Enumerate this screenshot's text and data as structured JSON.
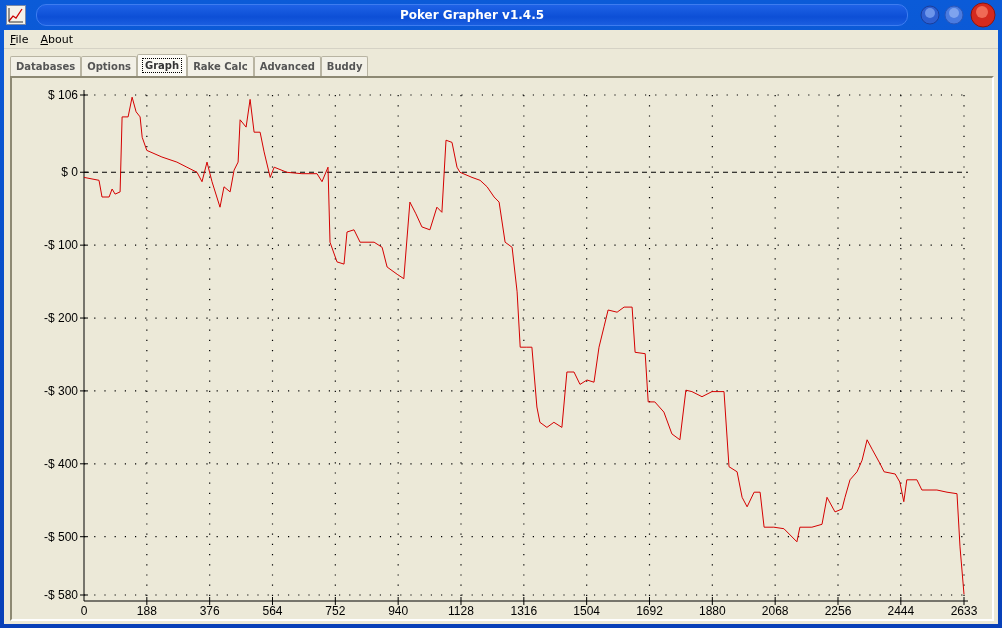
{
  "window": {
    "title": "Poker Grapher v1.4.5"
  },
  "menu": [
    "File",
    "About"
  ],
  "tabs": [
    {
      "label": "Databases",
      "selected": false
    },
    {
      "label": "Options",
      "selected": false
    },
    {
      "label": "Graph",
      "selected": true
    },
    {
      "label": "Rake Calc",
      "selected": false
    },
    {
      "label": "Advanced",
      "selected": false
    },
    {
      "label": "Buddy",
      "selected": false
    }
  ],
  "graph": {
    "chart_data": {
      "type": "line",
      "xlim": [
        0,
        2633
      ],
      "ylim": [
        -580,
        106
      ],
      "xticks": [
        0,
        188,
        376,
        564,
        752,
        940,
        1128,
        1316,
        1504,
        1692,
        1880,
        2068,
        2256,
        2444,
        2633
      ],
      "yticks": [
        {
          "value": 106,
          "label": "$ 106"
        },
        {
          "value": 0,
          "label": "$ 0"
        },
        {
          "value": -100,
          "label": "-$ 100"
        },
        {
          "value": -200,
          "label": "-$ 200"
        },
        {
          "value": -300,
          "label": "-$ 300"
        },
        {
          "value": -400,
          "label": "-$ 400"
        },
        {
          "value": -500,
          "label": "-$ 500"
        },
        {
          "value": -580,
          "label": "-$ 580"
        }
      ],
      "x": [
        0,
        45,
        54,
        75,
        84,
        93,
        108,
        114,
        132,
        144,
        156,
        168,
        174,
        188,
        233,
        278,
        308,
        338,
        353,
        368,
        383,
        407,
        419,
        437,
        449,
        461,
        467,
        485,
        497,
        509,
        527,
        539,
        557,
        569,
        607,
        652,
        697,
        712,
        730,
        736,
        757,
        778,
        787,
        808,
        826,
        868,
        892,
        907,
        937,
        957,
        975,
        993,
        1011,
        1035,
        1056,
        1071,
        1083,
        1101,
        1116,
        1125,
        1161,
        1185,
        1206,
        1227,
        1242,
        1260,
        1281,
        1296,
        1305,
        1325,
        1340,
        1355,
        1364,
        1385,
        1406,
        1430,
        1445,
        1466,
        1484,
        1505,
        1526,
        1541,
        1556,
        1568,
        1595,
        1616,
        1640,
        1649,
        1679,
        1688,
        1708,
        1735,
        1759,
        1783,
        1801,
        1819,
        1849,
        1879,
        1915,
        1930,
        1954,
        1969,
        1984,
        2005,
        2023,
        2035,
        2064,
        2094,
        2133,
        2142,
        2178,
        2208,
        2223,
        2247,
        2268,
        2277,
        2292,
        2313,
        2328,
        2343,
        2358,
        2382,
        2394,
        2427,
        2441,
        2453,
        2462,
        2492,
        2507,
        2552,
        2582,
        2612,
        2621,
        2633
      ],
      "grid": true,
      "series": [
        {
          "color": "#d40000",
          "values": [
            -7,
            -11,
            -34,
            -34,
            -23,
            -30,
            -27,
            76,
            76,
            103,
            83,
            76,
            48,
            30,
            21,
            14,
            7,
            0,
            -13,
            14,
            -13,
            -48,
            -20,
            -27,
            3,
            14,
            72,
            62,
            100,
            55,
            55,
            28,
            -7,
            7,
            0,
            -2,
            -2,
            -13,
            7,
            -96,
            -123,
            -126,
            -82,
            -79,
            -96,
            -96,
            -103,
            -130,
            -140,
            -146,
            -41,
            -57,
            -75,
            -79,
            -48,
            -55,
            44,
            41,
            7,
            0,
            -7,
            -11,
            -20,
            -34,
            -41,
            -96,
            -103,
            -164,
            -240,
            -240,
            -240,
            -322,
            -343,
            -350,
            -343,
            -350,
            -274,
            -274,
            -291,
            -285,
            -288,
            -240,
            -212,
            -189,
            -192,
            -185,
            -185,
            -247,
            -249,
            -315,
            -315,
            -329,
            -359,
            -367,
            -299,
            -301,
            -308,
            -301,
            -301,
            -404,
            -411,
            -446,
            -459,
            -439,
            -439,
            -487,
            -487,
            -489,
            -507,
            -487,
            -487,
            -483,
            -446,
            -466,
            -462,
            -446,
            -422,
            -411,
            -395,
            -367,
            -380,
            -400,
            -411,
            -414,
            -425,
            -452,
            -422,
            -422,
            -436,
            -436,
            -439,
            -441,
            -514,
            -579
          ]
        }
      ]
    }
  }
}
